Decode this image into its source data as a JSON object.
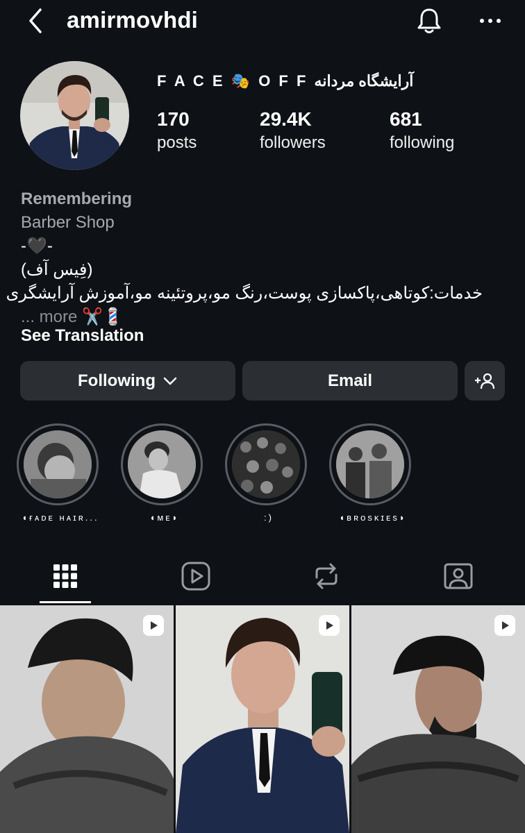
{
  "header": {
    "username": "amirmovhdi"
  },
  "profile": {
    "display_name": "F A C E 🎭 O F F آرایشگاه مردانه",
    "stats": [
      {
        "value": "170",
        "label": "posts"
      },
      {
        "value": "29.4K",
        "label": "followers"
      },
      {
        "value": "681",
        "label": "following"
      }
    ]
  },
  "bio": {
    "category": "Remembering",
    "subtitle": "Barber Shop",
    "line_heart": "-🖤-",
    "line_nickname": "(فِیس آف)",
    "line_services": "خدمات:کوتاهی،پاکسازی پوست،رنگ مو،پروتئینه مو،آموزش آرایشگری",
    "line_emoji": "✂️💈",
    "more": "... more",
    "see_translation": "See Translation"
  },
  "actions": {
    "following_label": "Following",
    "email_label": "Email"
  },
  "highlights": [
    {
      "label": "◖ғᴀᴅᴇ ʜᴀɪʀ..."
    },
    {
      "label": "◖ᴍᴇ◗"
    },
    {
      "label": ":)"
    },
    {
      "label": "◖ʙʀᴏsᴋɪᴇs◗"
    }
  ],
  "tabs": [
    {
      "icon": "grid-icon",
      "active": true
    },
    {
      "icon": "reels-icon",
      "active": false
    },
    {
      "icon": "repost-icon",
      "active": false
    },
    {
      "icon": "tagged-icon",
      "active": false
    }
  ],
  "colors": {
    "background": "#0e1116",
    "button": "#2b2e33",
    "secondary_text": "#a8a9ad"
  }
}
